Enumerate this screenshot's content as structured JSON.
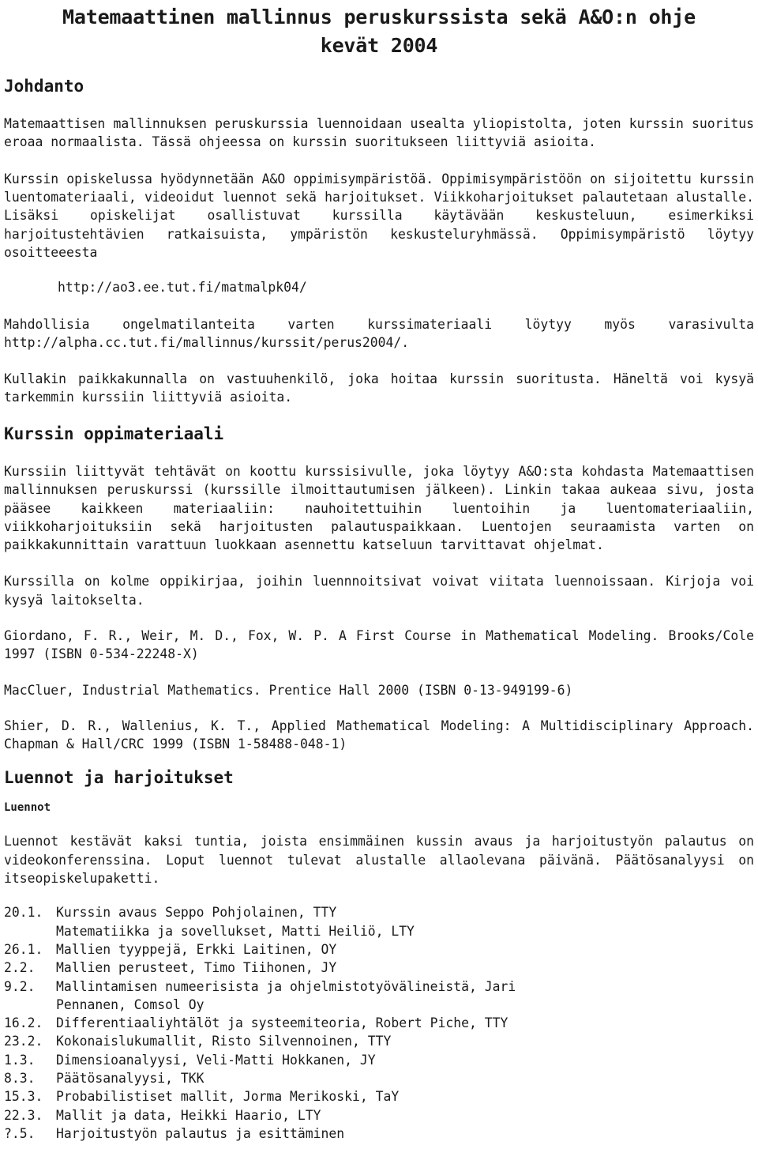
{
  "document": {
    "title_line1": "Matemaattinen mallinnus peruskurssista sekä A&O:n ohje",
    "title_line2": "kevät 2004"
  },
  "sections": {
    "intro": {
      "heading": "Johdanto",
      "p1": "Matemaattisen mallinnuksen peruskurssia luennoidaan usealta yliopistolta, joten kurssin suoritus eroaa normaalista. Tässä ohjeessa on kurssin suoritukseen liittyviä asioita.",
      "p2": "Kurssin opiskelussa hyödynnetään A&O oppimisympäristöä. Oppimisympäristöön on sijoitettu kurssin luentomateriaali, videoidut luennot sekä harjoitukset. Viikkoharjoitukset palautetaan alustalle. Lisäksi opiskelijat osallistuvat kurssilla käytävään keskusteluun, esimerkiksi harjoitustehtävien ratkaisuista, ympäristön keskusteluryhmässä. Oppimisympäristö löytyy osoitteeesta",
      "url_main": "http://ao3.ee.tut.fi/matmalpk04/",
      "p3": "Mahdollisia ongelmatilanteita varten kurssimateriaali löytyy myös varasivulta http://alpha.cc.tut.fi/mallinnus/kurssit/perus2004/.",
      "p4": "Kullakin paikkakunnalla on vastuuhenkilö, joka hoitaa kurssin suoritusta. Häneltä voi kysyä tarkemmin kurssiin liittyviä asioita."
    },
    "materials": {
      "heading": "Kurssin oppimateriaali",
      "p1": "Kurssiin liittyvät tehtävät on koottu kurssisivulle, joka löytyy A&O:sta kohdasta Matemaattisen mallinnuksen peruskurssi (kurssille ilmoittautumisen jälkeen). Linkin takaa aukeaa sivu, josta pääsee kaikkeen materiaaliin: nauhoitettuihin luentoihin ja luentomateriaaliin, viikkoharjoituksiin sekä harjoitusten palautuspaikkaan. Luentojen seuraamista varten on paikkakunnittain varattuun luokkaan asennettu katseluun tarvittavat ohjelmat.",
      "p2": "Kurssilla on kolme oppikirjaa, joihin luennnoitsivat voivat viitata luennoissaan. Kirjoja voi kysyä laitokselta.",
      "books": [
        "Giordano, F. R., Weir, M. D., Fox, W. P. A First Course in Mathematical Modeling. Brooks/Cole 1997 (ISBN 0-534-22248-X)",
        "MacCluer, Industrial Mathematics. Prentice Hall 2000 (ISBN 0-13-949199-6)",
        "Shier, D. R., Wallenius, K. T., Applied Mathematical Modeling: A Multidisciplinary Approach. Chapman & Hall/CRC 1999 (ISBN 1-58488-048-1)"
      ]
    },
    "lectures": {
      "heading": "Luennot ja harjoitukset",
      "subheading": "Luennot",
      "p1": "Luennot kestävät kaksi tuntia, joista ensimmäinen kussin avaus ja harjoitustyön palautus on videokonferenssina. Loput luennot tulevat alustalle allaolevana päivänä. Päätösanalyysi on itseopiskelupaketti.",
      "schedule": [
        {
          "date": "20.1.",
          "desc": "Kurssin avaus Seppo Pohjolainen, TTY",
          "cont": "Matematiikka ja sovellukset, Matti Heiliö, LTY"
        },
        {
          "date": "26.1.",
          "desc": "Mallien tyyppejä, Erkki Laitinen, OY",
          "cont": ""
        },
        {
          "date": "2.2.",
          "desc": "Mallien perusteet, Timo Tiihonen, JY",
          "cont": ""
        },
        {
          "date": "9.2.",
          "desc": "Mallintamisen numeerisista ja ohjelmistotyövälineistä, Jari",
          "cont": "Pennanen, Comsol Oy"
        },
        {
          "date": "16.2.",
          "desc": "Differentiaaliyhtälöt ja systeemiteoria, Robert Piche, TTY",
          "cont": ""
        },
        {
          "date": "23.2.",
          "desc": "Kokonaislukumallit, Risto Silvennoinen, TTY",
          "cont": ""
        },
        {
          "date": "1.3.",
          "desc": "Dimensioanalyysi, Veli-Matti Hokkanen, JY",
          "cont": ""
        },
        {
          "date": "8.3.",
          "desc": "Päätösanalyysi, TKK",
          "cont": ""
        },
        {
          "date": "15.3.",
          "desc": "Probabilistiset mallit, Jorma Merikoski, TaY",
          "cont": ""
        },
        {
          "date": "22.3.",
          "desc": "Mallit ja data, Heikki Haario, LTY",
          "cont": ""
        },
        {
          "date": "?.5.",
          "desc": "Harjoitustyön palautus ja esittäminen",
          "cont": ""
        }
      ]
    }
  }
}
